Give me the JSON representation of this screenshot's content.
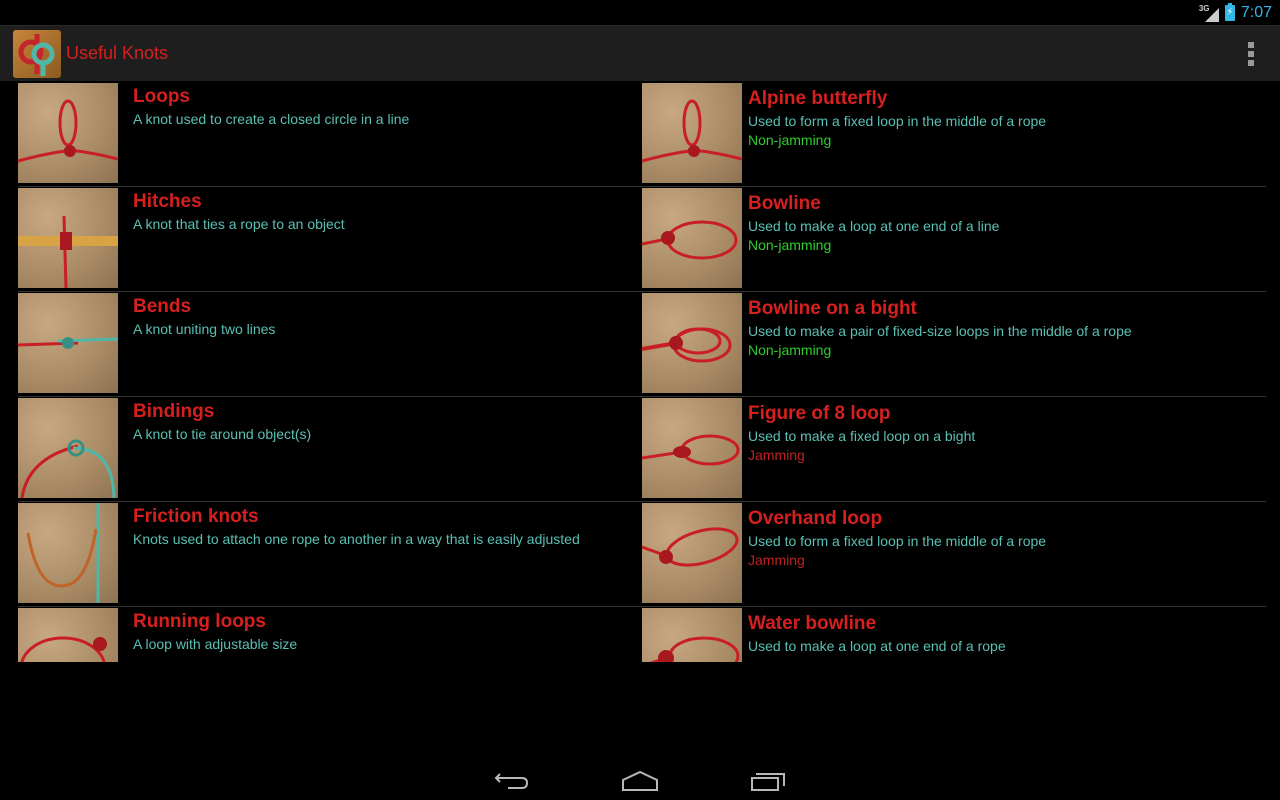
{
  "status_bar": {
    "network": "3G",
    "time": "7:07"
  },
  "action_bar": {
    "app_title": "Useful Knots",
    "overflow_icon": "overflow-menu-icon"
  },
  "colors": {
    "title_red": "#d5201f",
    "desc_teal": "#5ac0b4",
    "non_jamming_green": "#2fcc2f",
    "jamming_red": "#c02020",
    "clock_blue": "#33b5e5"
  },
  "categories": [
    {
      "title": "Loops",
      "description": "A knot used to create a closed circle in a line"
    },
    {
      "title": "Hitches",
      "description": "A knot that ties a rope to an object"
    },
    {
      "title": "Bends",
      "description": "A knot uniting two lines"
    },
    {
      "title": "Bindings",
      "description": "A knot to tie around object(s)"
    },
    {
      "title": "Friction knots",
      "description": "Knots used to attach one rope to another in a way that is easily adjusted"
    },
    {
      "title": "Running loops",
      "description": "A loop with adjustable size"
    }
  ],
  "knots": [
    {
      "title": "Alpine butterfly",
      "description": "Used to form a fixed loop in the middle of a rope",
      "status": "Non-jamming",
      "jamming": false
    },
    {
      "title": "Bowline",
      "description": "Used to make a loop at one end of a line",
      "status": "Non-jamming",
      "jamming": false
    },
    {
      "title": "Bowline on a bight",
      "description": "Used to make a pair of fixed-size loops in the middle of a rope",
      "status": "Non-jamming",
      "jamming": false
    },
    {
      "title": "Figure of 8 loop",
      "description": "Used to make a fixed loop on a bight",
      "status": "Jamming",
      "jamming": true
    },
    {
      "title": "Overhand loop",
      "description": "Used to form a fixed loop in the middle of a rope",
      "status": "Jamming",
      "jamming": true
    },
    {
      "title": "Water bowline",
      "description": "Used to make a loop at one end of a rope",
      "status": "",
      "jamming": false
    }
  ],
  "nav_bar": {
    "back": "back-icon",
    "home": "home-icon",
    "recents": "recents-icon"
  }
}
